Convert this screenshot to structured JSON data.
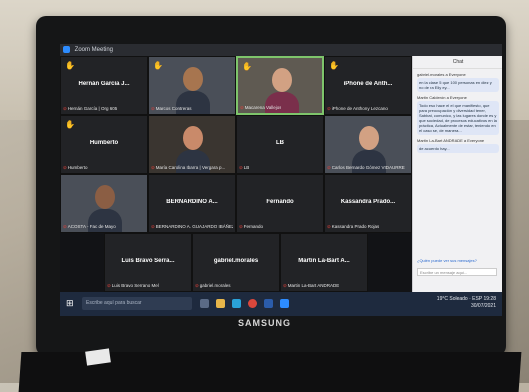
{
  "window": {
    "title": "Zoom Meeting"
  },
  "participants": [
    {
      "name": "Hernán García J...",
      "caption": "Hernán García | Org 605",
      "hand": true
    },
    {
      "name": "",
      "caption": "Marcos Contreras",
      "hand": true
    },
    {
      "name": "",
      "caption": "Macarena Vallejos",
      "hand": true
    },
    {
      "name": "iPhone de Anth...",
      "caption": "iPhone de Anthony Lezcano",
      "hand": true
    },
    {
      "name": "Humberto",
      "caption": "Humberto",
      "hand": true
    },
    {
      "name": "",
      "caption": "María Carolina Ibarra | Vergara p...",
      "hand": false
    },
    {
      "name": "LB",
      "caption": "LB",
      "hand": false
    },
    {
      "name": "",
      "caption": "Carlos Bernardo Gómez VIDAURRE",
      "hand": false
    },
    {
      "name": "",
      "caption": "ACOSTA - Fac de Mayo",
      "hand": false
    },
    {
      "name": "BERNARDINO A...",
      "caption": "BERNARDINO A. GUAJARDO IBÁÑEZ",
      "hand": false
    },
    {
      "name": "Fernando",
      "caption": "Fernando",
      "hand": false
    },
    {
      "name": "Kassandra Prado...",
      "caption": "Kassandra Prado Rojas",
      "hand": false
    },
    {
      "name": "Luis Bravo Serra...",
      "caption": "Luis Bravo Serrano Mel",
      "hand": false
    },
    {
      "name": "gabriel.morales",
      "caption": "gabriel.morales",
      "hand": false
    },
    {
      "name": "Martin La-Bart A...",
      "caption": "Martin La-Bart ANDRADE",
      "hand": false
    }
  ],
  "chat": {
    "header": "Chat",
    "messages": [
      {
        "from": "gabriel.morales a Everyone",
        "text": "en la clase 5 que 100 personas en diez y no de ra Eliy ey..."
      },
      {
        "from": "Martin Calderón a Everyone",
        "text": "Todo eso hace el el que manifiesto, que para preocupación y diversidad tener, Sabbat, comunico, y las lugares donde es y que sociedad, de procesos educativos en la práctica, Actualmente de estar, teniendo en el caso se, de manera..."
      },
      {
        "from": "Martin La-Bart ANDRADE a Everyone",
        "text": "de acuerdo hay..."
      }
    ],
    "input_placeholder": "Escribe un mensaje aquí...",
    "from_label": "¿Quién puede ver sus mensajes?"
  },
  "taskbar": {
    "search_placeholder": "Escribe aquí para buscar",
    "weather": "19°C  Soleado",
    "lang": "ESP",
    "time": "19:28",
    "date": "30/07/2021"
  },
  "brand": "SAMSUNG",
  "colors": {
    "zoom_blue": "#2d8cff",
    "active_speaker": "#7ec56b",
    "raise_hand": "#f5c24a"
  }
}
